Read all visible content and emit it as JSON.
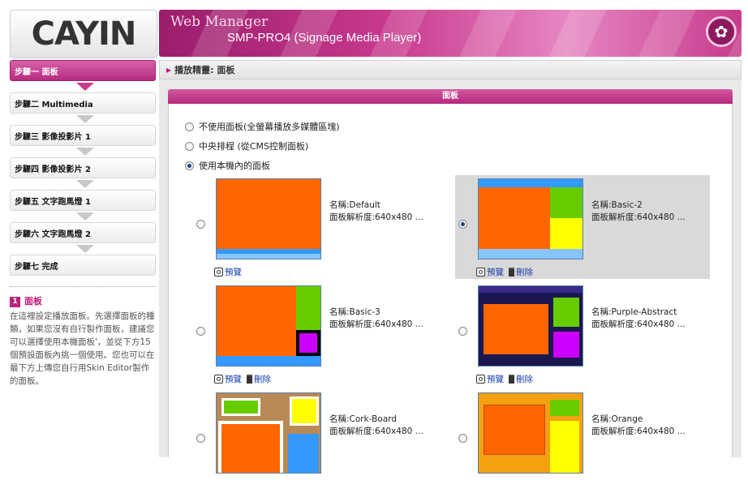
{
  "header": {
    "logo_text": "CAYIN",
    "web_manager": "Web Manager",
    "product": "SMP-PRO4 (Signage Media Player)"
  },
  "sidebar": {
    "steps": [
      {
        "label": "步驟一 面板",
        "active": true
      },
      {
        "label": "步驟二 Multimedia",
        "active": false
      },
      {
        "label": "步驟三 影像投影片 1",
        "active": false
      },
      {
        "label": "步驟四 影像投影片 2",
        "active": false
      },
      {
        "label": "步驟五 文字跑馬燈 1",
        "active": false
      },
      {
        "label": "步驟六 文字跑馬燈 2",
        "active": false
      },
      {
        "label": "步驟七 完成",
        "active": false
      }
    ],
    "help_title": "面板",
    "help_number": "1",
    "help_text": "在這裡設定播放面板。先選擇面板的種類，如果您沒有自行製作面板，建議您可以選擇使用本機面板'，並從下方15個預設面板內挑一個使用。您也可以在最下方上傳您自行用Skin Editor製作的面板。"
  },
  "breadcrumb": "播放精靈: 面板",
  "panel": {
    "title": "面板",
    "options": [
      {
        "label": "不使用面板(全螢幕播放多媒體區塊)",
        "checked": false
      },
      {
        "label": "中央排程 (從CMS控制面板)",
        "checked": false
      },
      {
        "label": "使用本機內的面板",
        "checked": true
      }
    ],
    "skins": [
      {
        "name": "名稱:Default",
        "res": "面板解析度:640x480 ...",
        "selected": false,
        "preview": "預覽",
        "delete": ""
      },
      {
        "name": "名稱:Basic-2",
        "res": "面板解析度:640x480 ...",
        "selected": true,
        "preview": "預覽",
        "delete": "刪除"
      },
      {
        "name": "名稱:Basic-3",
        "res": "面板解析度:640x480 ...",
        "selected": false,
        "preview": "預覽",
        "delete": "刪除"
      },
      {
        "name": "名稱:Purple-Abstract",
        "res": "面板解析度:640x480 ...",
        "selected": false,
        "preview": "預覽",
        "delete": "刪除"
      },
      {
        "name": "名稱:Cork-Board",
        "res": "面板解析度:640x480 ...",
        "selected": false,
        "preview": "",
        "delete": ""
      },
      {
        "name": "名稱:Orange",
        "res": "面板解析度:640x480 ...",
        "selected": false,
        "preview": "",
        "delete": ""
      }
    ]
  },
  "colors": {
    "accent": "#c2167a",
    "link": "#1840a8",
    "skin_orange": "#ff6600",
    "skin_green": "#66cc00",
    "skin_yellow": "#ffff00",
    "skin_blue": "#3399ff"
  }
}
